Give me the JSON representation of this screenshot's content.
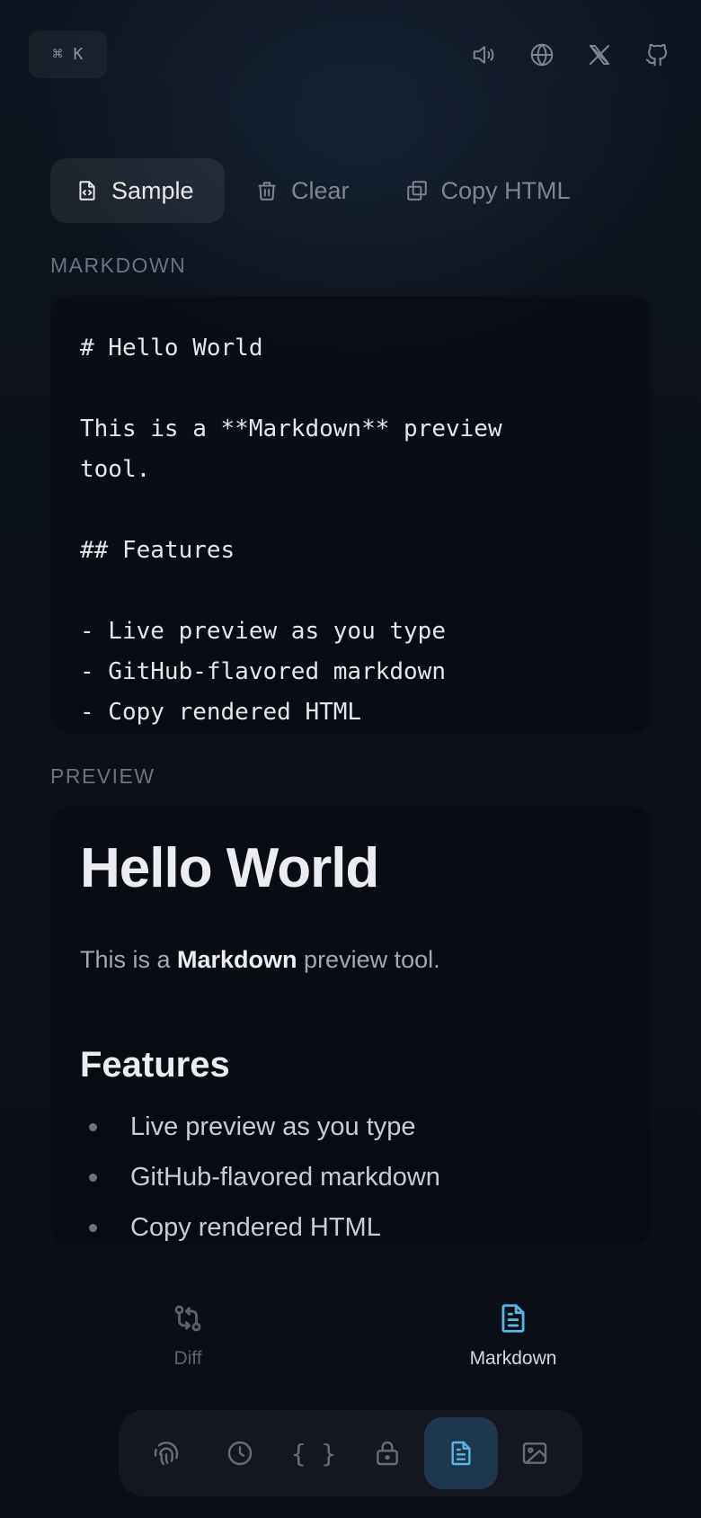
{
  "topbar": {
    "shortcut_symbol": "⌘",
    "shortcut_key": "K",
    "icons": [
      "speaker-icon",
      "globe-icon",
      "x-logo-icon",
      "github-icon"
    ]
  },
  "toolbar": {
    "sample_label": "Sample",
    "clear_label": "Clear",
    "copy_html_label": "Copy HTML"
  },
  "markdown_section": {
    "label": "MARKDOWN",
    "content": "# Hello World\n\nThis is a **Markdown** preview tool.\n\n## Features\n\n- Live preview as you type\n- GitHub-flavored markdown\n- Copy rendered HTML"
  },
  "preview_section": {
    "label": "PREVIEW",
    "heading": "Hello World",
    "paragraph_prefix": "This is a ",
    "paragraph_bold": "Markdown",
    "paragraph_suffix": " preview tool.",
    "subheading": "Features",
    "items": [
      "Live preview as you type",
      "GitHub-flavored markdown",
      "Copy rendered HTML"
    ]
  },
  "modes": {
    "diff_label": "Diff",
    "markdown_label": "Markdown",
    "active": "Markdown"
  },
  "dock": {
    "items": [
      "fingerprint-icon",
      "clock-icon",
      "braces-icon",
      "lock-icon",
      "document-icon",
      "image-icon"
    ],
    "braces_glyph": "{ }",
    "active": "document-icon"
  },
  "colors": {
    "accent": "#5ab4e6",
    "background": "#0b0e15",
    "muted": "#6b7281"
  }
}
